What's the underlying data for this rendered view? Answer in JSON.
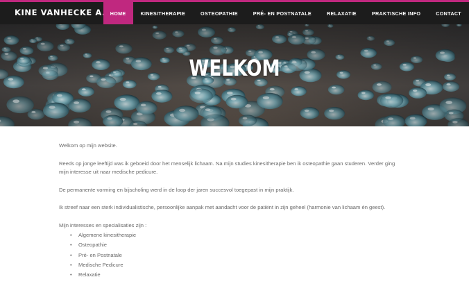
{
  "site": {
    "logo": "KINE VANHECKE A."
  },
  "nav": {
    "items": [
      {
        "label": "HOME",
        "active": true
      },
      {
        "label": "KINESITHERAPIE",
        "active": false
      },
      {
        "label": "OSTEOPATHIE",
        "active": false
      },
      {
        "label": "PRÉ- EN POSTNATALE",
        "active": false
      },
      {
        "label": "RELAXATIE",
        "active": false
      },
      {
        "label": "PRAKTISCHE INFO",
        "active": false
      },
      {
        "label": "CONTACT",
        "active": false
      }
    ]
  },
  "hero": {
    "title": "WELKOM",
    "image": "water-droplets"
  },
  "content": {
    "paragraphs": [
      "Welkom op mijn website.",
      "Reeds op jonge leeftijd was ik geboeid door het menselijk lichaam. Na mijn studies kinesitherapie ben ik osteopathie gaan studeren. Verder ging mijn interesse uit naar medische pedicure.",
      "De permanente vorming en bijscholing werd in de loop der jaren succesvol toegepast in mijn praktijk.",
      "Ik streef naar een sterk individualistische, persoonlijke aanpak met aandacht voor de patiënt in zijn geheel (harmonie van lichaam én geest).",
      "Mijn interesses en specialisaties zijn :"
    ],
    "list": [
      "Algemene kinesitherapie",
      "Osteopathie",
      "Pré- en Postnatale",
      "Medische Pedicure",
      "Relaxatie"
    ]
  },
  "colors": {
    "accent": "#c0287f",
    "topbar": "#1c1c1c",
    "text": "#6a6a6a"
  }
}
